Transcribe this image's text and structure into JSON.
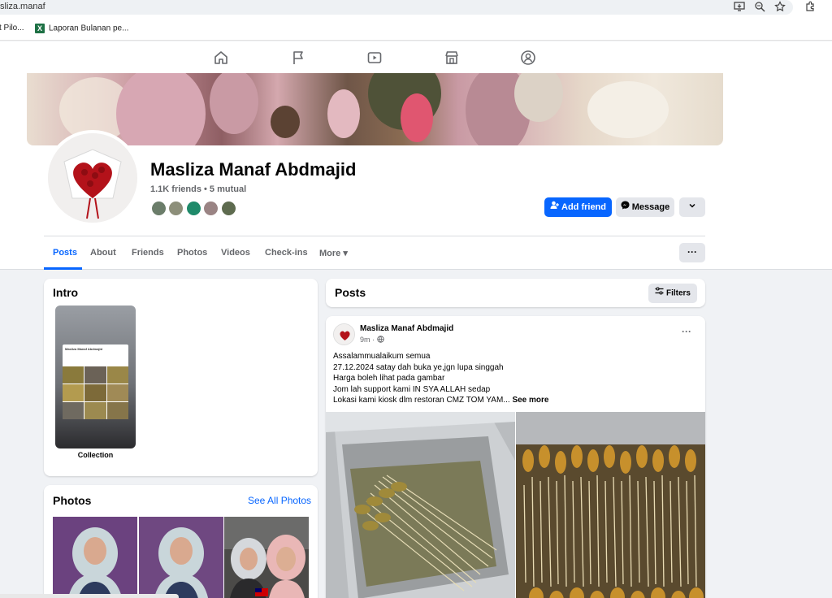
{
  "browser": {
    "url": "sliza.manaf",
    "bookmarks": [
      {
        "label": "t Pilo..."
      },
      {
        "label": "Laporan Bulanan pe..."
      }
    ],
    "icons": [
      "install-app-icon",
      "zoom-icon",
      "bookmark-star-icon",
      "extensions-icon"
    ]
  },
  "fb_nav": {
    "icons": [
      "home-icon",
      "pages-flag-icon",
      "video-icon",
      "marketplace-icon",
      "groups-icon"
    ]
  },
  "profile": {
    "name": "Masliza Manaf Abdmajid",
    "friends_text": "1.1K friends • 5 mutual",
    "add_friend_label": "Add friend",
    "message_label": "Message",
    "mutual_colors": [
      "#6b7d6a",
      "#8d8f7a",
      "#1f8a6a",
      "#9a8484",
      "#5e6b4f"
    ]
  },
  "tabs": [
    {
      "label": "Posts",
      "active": true
    },
    {
      "label": "About"
    },
    {
      "label": "Friends"
    },
    {
      "label": "Photos"
    },
    {
      "label": "Videos"
    },
    {
      "label": "Check-ins"
    },
    {
      "label": "More ▾"
    }
  ],
  "intro": {
    "title": "Intro",
    "collection_label": "Collection",
    "collection_preview_title": "Masliza Manaf Abdmajid"
  },
  "photos": {
    "title": "Photos",
    "see_all": "See All Photos"
  },
  "posts_header": {
    "title": "Posts",
    "filters_label": "Filters"
  },
  "post": {
    "author": "Masliza Manaf Abdmajid",
    "time": "9m ·",
    "lines": [
      "Assalammualaikum semua",
      "27.12.2024 satay dah buka ye,jgn lupa singgah",
      "Harga boleh lihat pada gambar",
      "Jom lah support kami IN SYA ALLAH sedap",
      "Lokasi kami kiosk dlm restoran CMZ TOM YAM..."
    ],
    "see_more": "See more"
  },
  "colors": {
    "accent": "#0866ff",
    "page_bg": "#f0f2f5",
    "secondary_text": "#65676b"
  }
}
